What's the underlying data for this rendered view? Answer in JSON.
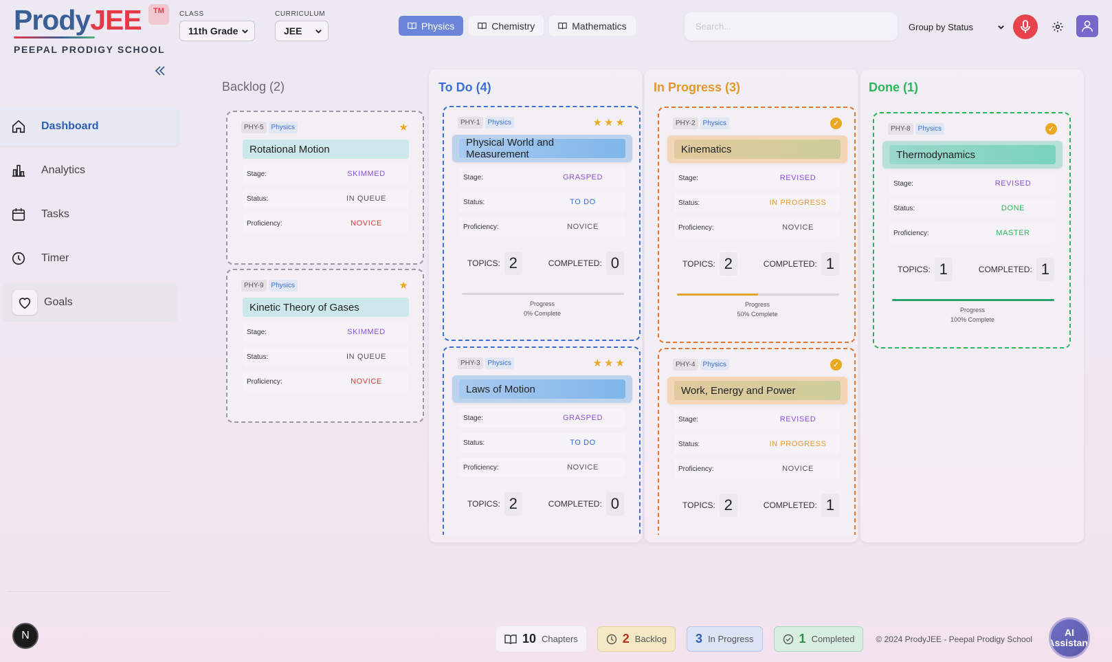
{
  "brand": {
    "name_part1": "Prody",
    "name_part2": "JEE",
    "tm": "TM",
    "school": "PEEPAL PRODIGY SCHOOL"
  },
  "selectors": {
    "class_label": "CLASS",
    "class_value": "11th Grade",
    "curriculum_label": "CURRICULUM",
    "curriculum_value": "JEE"
  },
  "subjects": [
    {
      "label": "Physics",
      "active": true
    },
    {
      "label": "Chemistry",
      "active": false
    },
    {
      "label": "Mathematics",
      "active": false
    }
  ],
  "search": {
    "placeholder": "Search..."
  },
  "group_by": {
    "value": "Group by Status"
  },
  "sidebar": {
    "items": [
      {
        "label": "Dashboard",
        "icon": "home-icon",
        "active": true
      },
      {
        "label": "Analytics",
        "icon": "bar-chart-icon"
      },
      {
        "label": "Tasks",
        "icon": "calendar-icon"
      },
      {
        "label": "Timer",
        "icon": "clock-icon"
      },
      {
        "label": "Goals",
        "icon": "heart-icon"
      }
    ],
    "badge": "N"
  },
  "columns": {
    "backlog": {
      "title": "Backlog (2)",
      "color": "#6a6a72"
    },
    "todo": {
      "title": "To Do (4)",
      "color": "#3a6fd8"
    },
    "in_progress": {
      "title": "In Progress (3)",
      "color": "#e3962a"
    },
    "done": {
      "title": "Done (1)",
      "color": "#2bb65c"
    }
  },
  "labels": {
    "stage": "Stage:",
    "status": "Status:",
    "proficiency": "Proficiency:",
    "topics": "TOPICS:",
    "completed": "COMPLETED:",
    "progress": "Progress"
  },
  "cards": {
    "phy5": {
      "code": "PHY-5",
      "subject": "Physics",
      "title": "Rotational Motion",
      "stage": "SKIMMED",
      "status": "IN QUEUE",
      "proficiency": "NOVICE"
    },
    "phy9": {
      "code": "PHY-9",
      "subject": "Physics",
      "title": "Kinetic Theory of Gases",
      "stage": "SKIMMED",
      "status": "IN QUEUE",
      "proficiency": "NOVICE"
    },
    "phy1": {
      "code": "PHY-1",
      "subject": "Physics",
      "title": "Physical World and Measurement",
      "stage": "GRASPED",
      "status": "TO DO",
      "proficiency": "NOVICE",
      "topics": "2",
      "completed": "0",
      "progress_pct": 0,
      "progress_text": "0% Complete",
      "stars": "★★★"
    },
    "phy3": {
      "code": "PHY-3",
      "subject": "Physics",
      "title": "Laws of Motion",
      "stage": "GRASPED",
      "status": "TO DO",
      "proficiency": "NOVICE",
      "topics": "2",
      "completed": "0",
      "stars": "★★★"
    },
    "phy2": {
      "code": "PHY-2",
      "subject": "Physics",
      "title": "Kinematics",
      "stage": "REVISED",
      "status": "IN PROGRESS",
      "proficiency": "NOVICE",
      "topics": "2",
      "completed": "1",
      "progress_pct": 50,
      "progress_text": "50% Complete"
    },
    "phy4": {
      "code": "PHY-4",
      "subject": "Physics",
      "title": "Work, Energy and Power",
      "stage": "REVISED",
      "status": "IN PROGRESS",
      "proficiency": "NOVICE",
      "topics": "2",
      "completed": "1"
    },
    "phy8": {
      "code": "PHY-8",
      "subject": "Physics",
      "title": "Thermodynamics",
      "stage": "REVISED",
      "status": "DONE",
      "proficiency": "MASTER",
      "topics": "1",
      "completed": "1",
      "progress_pct": 100,
      "progress_text": "100% Complete"
    }
  },
  "footer": {
    "chapters_count": "10",
    "chapters_label": "Chapters",
    "backlog_count": "2",
    "backlog_label": "Backlog",
    "in_progress_count": "3",
    "in_progress_label": "In Progress",
    "completed_count": "1",
    "completed_label": "Completed",
    "copyright": "© 2024 ProdyJEE - Peepal Prodigy School"
  },
  "assistant": {
    "label": "AI Assistant"
  },
  "colors": {
    "accent": "#6b86d8",
    "mic": "#e8424d",
    "avatar": "#7668c9",
    "star": "#eaa923"
  }
}
